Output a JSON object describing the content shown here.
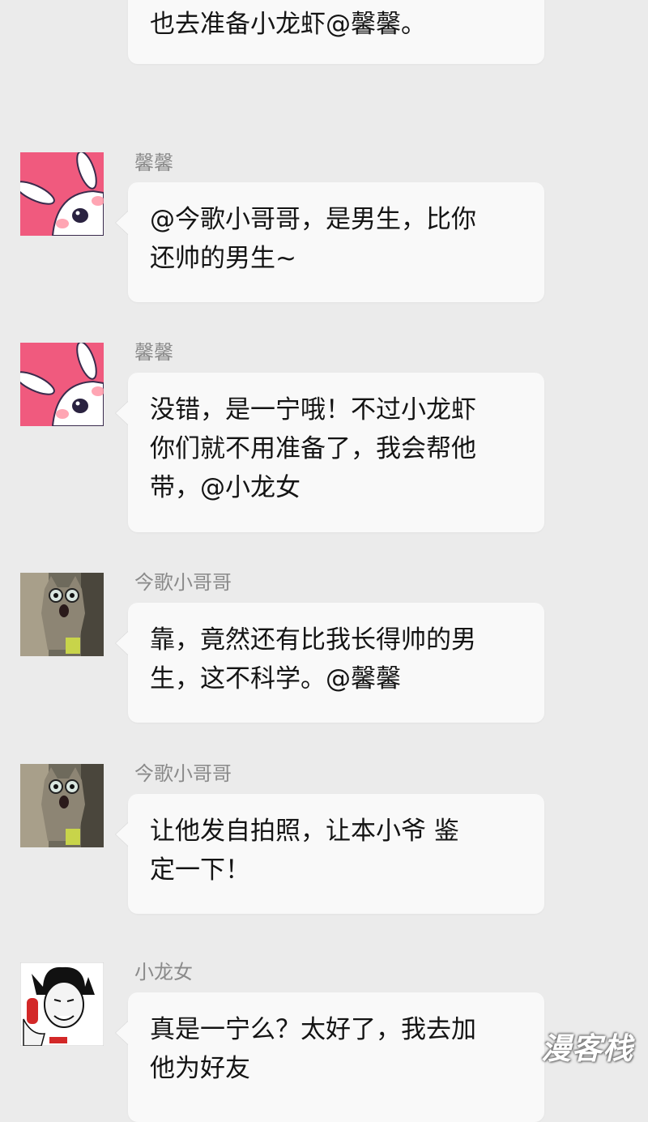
{
  "messages": [
    {
      "sender": "",
      "text": "也去准备小龙虾@馨馨。"
    },
    {
      "sender": "馨馨",
      "avatar": "bunny-avatar",
      "text": "@今歌小哥哥，是男生，比你\n还帅的男生~"
    },
    {
      "sender": "馨馨",
      "avatar": "bunny-avatar",
      "text": "没错，是一宁哦！不过小龙虾\n你们就不用准备了，我会帮他\n带，@小龙女"
    },
    {
      "sender": "今歌小哥哥",
      "avatar": "cat-avatar",
      "text": "靠，竟然还有比我长得帅的男\n生，这不科学。@馨馨"
    },
    {
      "sender": "今歌小哥哥",
      "avatar": "cat-avatar",
      "text": "让他发自拍照，让本小爷 鉴\n定一下！"
    },
    {
      "sender": "小龙女",
      "avatar": "meme-face-avatar",
      "text": "真是一宁么？太好了，我去加\n他为好友"
    }
  ],
  "watermark": "漫客栈",
  "colors": {
    "background": "#ebebeb",
    "bubble": "#f9f9f9",
    "sender_name": "#8a8a8a",
    "bunny_pink": "#f05a7e"
  }
}
